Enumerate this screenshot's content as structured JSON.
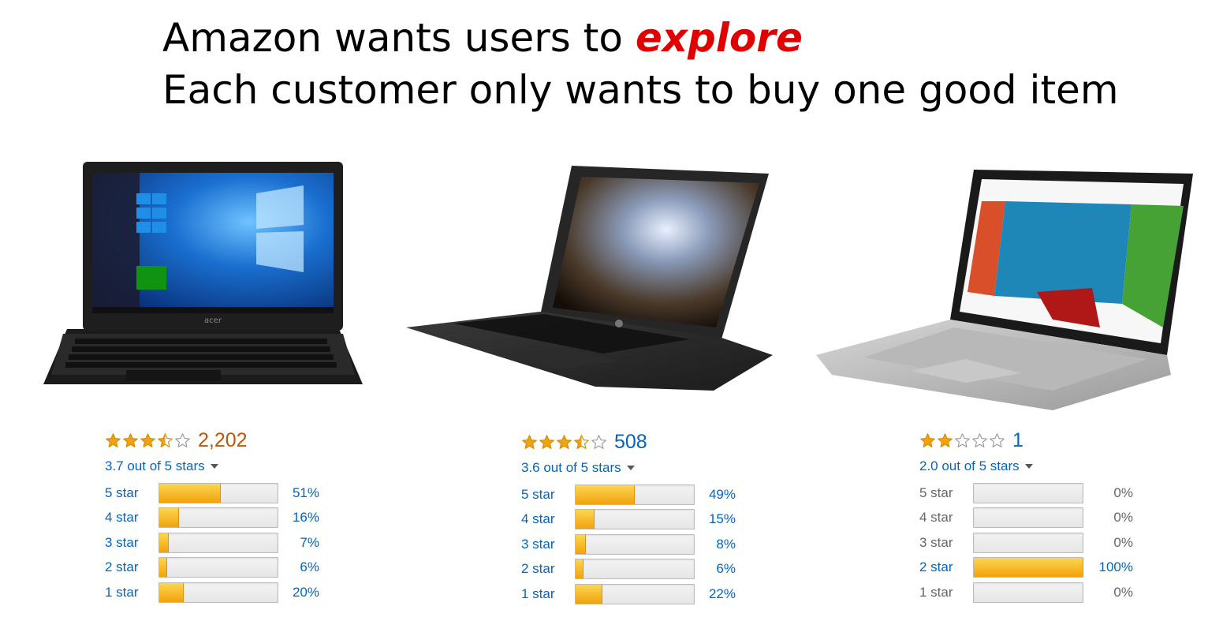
{
  "headline": {
    "line1_prefix": "Amazon wants users to ",
    "line1_emphasis": "explore",
    "line2": "Each customer only wants to buy one good item"
  },
  "products": [
    {
      "name_icon": "acer-laptop-image",
      "stars": 3.5,
      "review_count": "2,202",
      "summary": "3.7 out of 5 stars",
      "histogram": [
        {
          "label": "5 star",
          "pct": "51%",
          "value": 51
        },
        {
          "label": "4 star",
          "pct": "16%",
          "value": 16
        },
        {
          "label": "3 star",
          "pct": "7%",
          "value": 7
        },
        {
          "label": "2 star",
          "pct": "6%",
          "value": 6
        },
        {
          "label": "1 star",
          "pct": "20%",
          "value": 20
        }
      ]
    },
    {
      "name_icon": "hp-laptop-image",
      "stars": 3.5,
      "review_count": "508",
      "summary": "3.6 out of 5 stars",
      "histogram": [
        {
          "label": "5 star",
          "pct": "49%",
          "value": 49
        },
        {
          "label": "4 star",
          "pct": "15%",
          "value": 15
        },
        {
          "label": "3 star",
          "pct": "8%",
          "value": 8
        },
        {
          "label": "2 star",
          "pct": "6%",
          "value": 6
        },
        {
          "label": "1 star",
          "pct": "22%",
          "value": 22
        }
      ]
    },
    {
      "name_icon": "lenovo-laptop-image",
      "stars": 2,
      "review_count": "1",
      "summary": "2.0 out of 5 stars",
      "histogram": [
        {
          "label": "5 star",
          "pct": "0%",
          "value": 0
        },
        {
          "label": "4 star",
          "pct": "0%",
          "value": 0
        },
        {
          "label": "3 star",
          "pct": "0%",
          "value": 0
        },
        {
          "label": "2 star",
          "pct": "100%",
          "value": 100
        },
        {
          "label": "1 star",
          "pct": "0%",
          "value": 0
        }
      ]
    }
  ],
  "colors": {
    "emphasis": "#e00000",
    "star": "#f0a30c",
    "link": "#0066c0",
    "count_orange": "#c45500"
  }
}
